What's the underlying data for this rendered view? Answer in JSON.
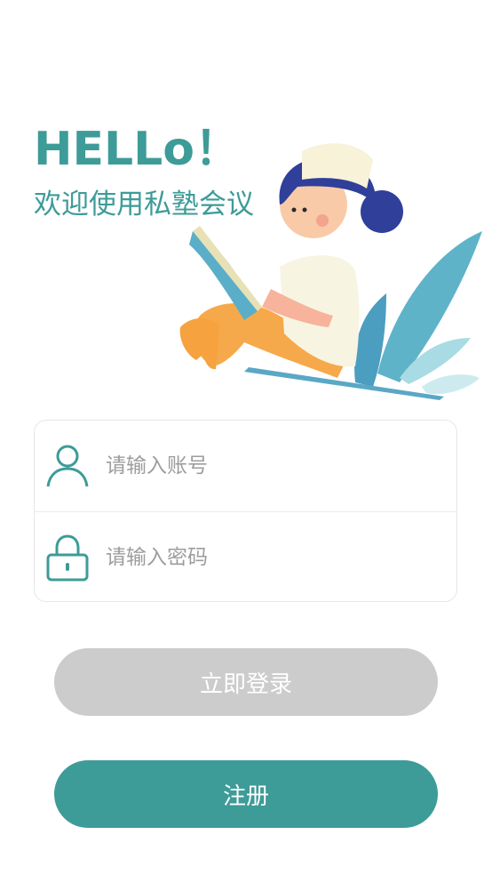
{
  "header": {
    "greeting": "HELLo！",
    "welcome": "欢迎使用私塾会议"
  },
  "form": {
    "account_placeholder": "请输入账号",
    "account_value": "",
    "password_placeholder": "请输入密码",
    "password_value": ""
  },
  "buttons": {
    "login_label": "立即登录",
    "register_label": "注册"
  },
  "icons": {
    "account": "user-icon",
    "password": "lock-icon"
  },
  "colors": {
    "accent": "#3d9b98",
    "login_disabled": "#cccccc",
    "placeholder": "#9d9d9d"
  }
}
